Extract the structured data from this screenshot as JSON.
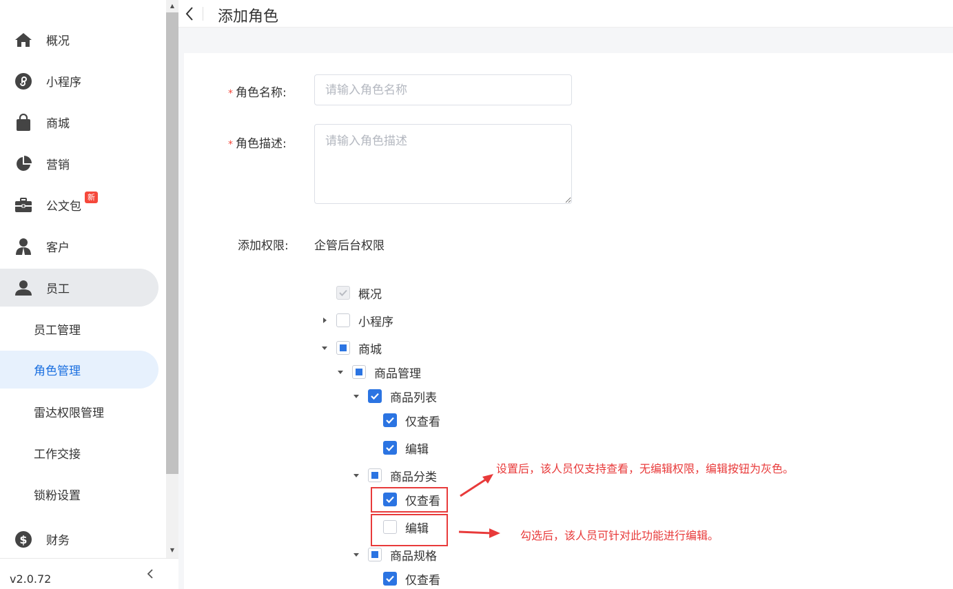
{
  "sidebar": {
    "items": [
      {
        "label": "概况",
        "icon": "home-icon"
      },
      {
        "label": "小程序",
        "icon": "mini-program-icon"
      },
      {
        "label": "商城",
        "icon": "shopping-bag-icon"
      },
      {
        "label": "营销",
        "icon": "pie-chart-icon"
      },
      {
        "label": "公文包",
        "icon": "briefcase-icon",
        "badge": "新"
      },
      {
        "label": "客户",
        "icon": "customer-icon"
      },
      {
        "label": "员工",
        "icon": "user-icon"
      }
    ],
    "sub_items": [
      {
        "label": "员工管理"
      },
      {
        "label": "角色管理"
      },
      {
        "label": "雷达权限管理"
      },
      {
        "label": "工作交接"
      },
      {
        "label": "锁粉设置"
      }
    ],
    "finance": {
      "label": "财务",
      "icon": "dollar-icon"
    },
    "version": "v2.0.72"
  },
  "header": {
    "title": "添加角色"
  },
  "form": {
    "name_label": "角色名称:",
    "name_placeholder": "请输入角色名称",
    "desc_label": "角色描述:",
    "desc_placeholder": "请输入角色描述",
    "perm_label": "添加权限:",
    "perm_value": "企管后台权限",
    "required_mark": "*"
  },
  "tree": [
    {
      "label": "概况",
      "state": "disabled-checked",
      "caret": "none"
    },
    {
      "label": "小程序",
      "state": "unchecked",
      "caret": "right"
    },
    {
      "label": "商城",
      "state": "half",
      "caret": "down"
    },
    {
      "label": "商品管理",
      "state": "half",
      "caret": "down"
    },
    {
      "label": "商品列表",
      "state": "checked",
      "caret": "down"
    },
    {
      "label": "仅查看",
      "state": "checked",
      "caret": "none"
    },
    {
      "label": "编辑",
      "state": "checked",
      "caret": "none"
    },
    {
      "label": "商品分类",
      "state": "half",
      "caret": "down"
    },
    {
      "label": "仅查看",
      "state": "checked",
      "caret": "none"
    },
    {
      "label": "编辑",
      "state": "unchecked",
      "caret": "none"
    },
    {
      "label": "商品规格",
      "state": "half",
      "caret": "down"
    },
    {
      "label": "仅查看",
      "state": "checked",
      "caret": "none"
    }
  ],
  "annotations": {
    "note1": "设置后，该人员仅支持查看，无编辑权限，编辑按钮为灰色。",
    "note2": "勾选后，该人员可针对此功能进行编辑。",
    "color": "#e83a3a"
  },
  "colors": {
    "accent": "#2b74e2",
    "active_bg": "#e7f1fd",
    "danger": "#f5483b"
  }
}
